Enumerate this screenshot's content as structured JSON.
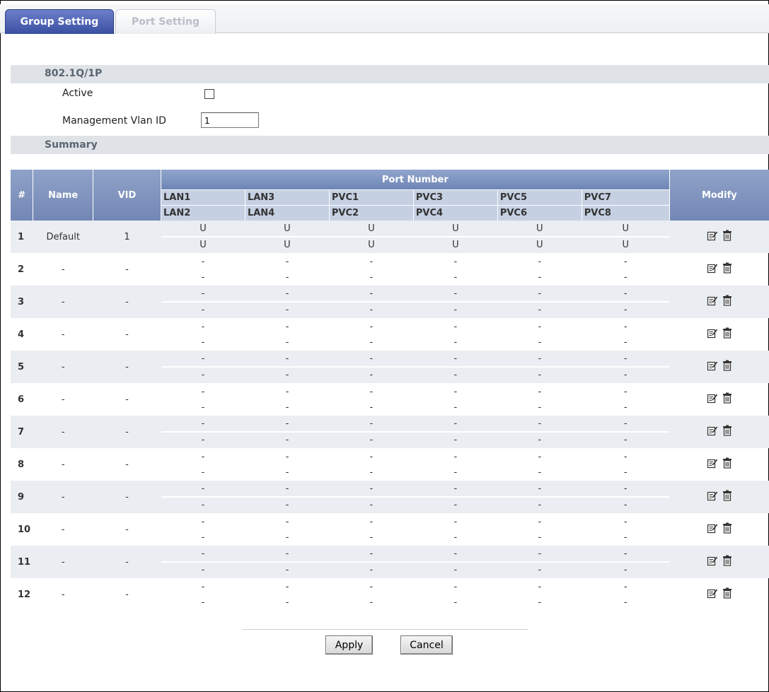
{
  "tabs": [
    {
      "label": "Group Setting",
      "active": true
    },
    {
      "label": "Port Setting",
      "active": false
    }
  ],
  "section_8021q": {
    "title": "802.1Q/1P",
    "active_label": "Active",
    "active_checked": false,
    "mgmt_label": "Management Vlan ID",
    "mgmt_value": "1"
  },
  "summary": {
    "title": "Summary",
    "headers": {
      "num": "#",
      "name": "Name",
      "vid": "VID",
      "port_number": "Port Number",
      "modify": "Modify"
    },
    "port_columns": [
      {
        "top": "LAN1",
        "bottom": "LAN2"
      },
      {
        "top": "LAN3",
        "bottom": "LAN4"
      },
      {
        "top": "PVC1",
        "bottom": "PVC2"
      },
      {
        "top": "PVC3",
        "bottom": "PVC4"
      },
      {
        "top": "PVC5",
        "bottom": "PVC6"
      },
      {
        "top": "PVC7",
        "bottom": "PVC8"
      }
    ],
    "rows": [
      {
        "num": "1",
        "name": "Default",
        "vid": "1",
        "ports": [
          [
            "U",
            "U"
          ],
          [
            "U",
            "U"
          ],
          [
            "U",
            "U"
          ],
          [
            "U",
            "U"
          ],
          [
            "U",
            "U"
          ],
          [
            "U",
            "U"
          ]
        ]
      },
      {
        "num": "2",
        "name": "-",
        "vid": "-",
        "ports": [
          [
            "-",
            "-"
          ],
          [
            "-",
            "-"
          ],
          [
            "-",
            "-"
          ],
          [
            "-",
            "-"
          ],
          [
            "-",
            "-"
          ],
          [
            "-",
            "-"
          ]
        ]
      },
      {
        "num": "3",
        "name": "-",
        "vid": "-",
        "ports": [
          [
            "-",
            "-"
          ],
          [
            "-",
            "-"
          ],
          [
            "-",
            "-"
          ],
          [
            "-",
            "-"
          ],
          [
            "-",
            "-"
          ],
          [
            "-",
            "-"
          ]
        ]
      },
      {
        "num": "4",
        "name": "-",
        "vid": "-",
        "ports": [
          [
            "-",
            "-"
          ],
          [
            "-",
            "-"
          ],
          [
            "-",
            "-"
          ],
          [
            "-",
            "-"
          ],
          [
            "-",
            "-"
          ],
          [
            "-",
            "-"
          ]
        ]
      },
      {
        "num": "5",
        "name": "-",
        "vid": "-",
        "ports": [
          [
            "-",
            "-"
          ],
          [
            "-",
            "-"
          ],
          [
            "-",
            "-"
          ],
          [
            "-",
            "-"
          ],
          [
            "-",
            "-"
          ],
          [
            "-",
            "-"
          ]
        ]
      },
      {
        "num": "6",
        "name": "-",
        "vid": "-",
        "ports": [
          [
            "-",
            "-"
          ],
          [
            "-",
            "-"
          ],
          [
            "-",
            "-"
          ],
          [
            "-",
            "-"
          ],
          [
            "-",
            "-"
          ],
          [
            "-",
            "-"
          ]
        ]
      },
      {
        "num": "7",
        "name": "-",
        "vid": "-",
        "ports": [
          [
            "-",
            "-"
          ],
          [
            "-",
            "-"
          ],
          [
            "-",
            "-"
          ],
          [
            "-",
            "-"
          ],
          [
            "-",
            "-"
          ],
          [
            "-",
            "-"
          ]
        ]
      },
      {
        "num": "8",
        "name": "-",
        "vid": "-",
        "ports": [
          [
            "-",
            "-"
          ],
          [
            "-",
            "-"
          ],
          [
            "-",
            "-"
          ],
          [
            "-",
            "-"
          ],
          [
            "-",
            "-"
          ],
          [
            "-",
            "-"
          ]
        ]
      },
      {
        "num": "9",
        "name": "-",
        "vid": "-",
        "ports": [
          [
            "-",
            "-"
          ],
          [
            "-",
            "-"
          ],
          [
            "-",
            "-"
          ],
          [
            "-",
            "-"
          ],
          [
            "-",
            "-"
          ],
          [
            "-",
            "-"
          ]
        ]
      },
      {
        "num": "10",
        "name": "-",
        "vid": "-",
        "ports": [
          [
            "-",
            "-"
          ],
          [
            "-",
            "-"
          ],
          [
            "-",
            "-"
          ],
          [
            "-",
            "-"
          ],
          [
            "-",
            "-"
          ],
          [
            "-",
            "-"
          ]
        ]
      },
      {
        "num": "11",
        "name": "-",
        "vid": "-",
        "ports": [
          [
            "-",
            "-"
          ],
          [
            "-",
            "-"
          ],
          [
            "-",
            "-"
          ],
          [
            "-",
            "-"
          ],
          [
            "-",
            "-"
          ],
          [
            "-",
            "-"
          ]
        ]
      },
      {
        "num": "12",
        "name": "-",
        "vid": "-",
        "ports": [
          [
            "-",
            "-"
          ],
          [
            "-",
            "-"
          ],
          [
            "-",
            "-"
          ],
          [
            "-",
            "-"
          ],
          [
            "-",
            "-"
          ],
          [
            "-",
            "-"
          ]
        ]
      }
    ]
  },
  "buttons": {
    "apply": "Apply",
    "cancel": "Cancel"
  },
  "icons": {
    "edit": "edit-icon",
    "delete": "trash-icon"
  },
  "colors": {
    "tab_active": "#3b4fa1",
    "header_blue": "#7a8fbd",
    "subheader": "#c6d0e3",
    "section_bar": "#dfe3e8",
    "row_shade": "#eaedf1"
  }
}
